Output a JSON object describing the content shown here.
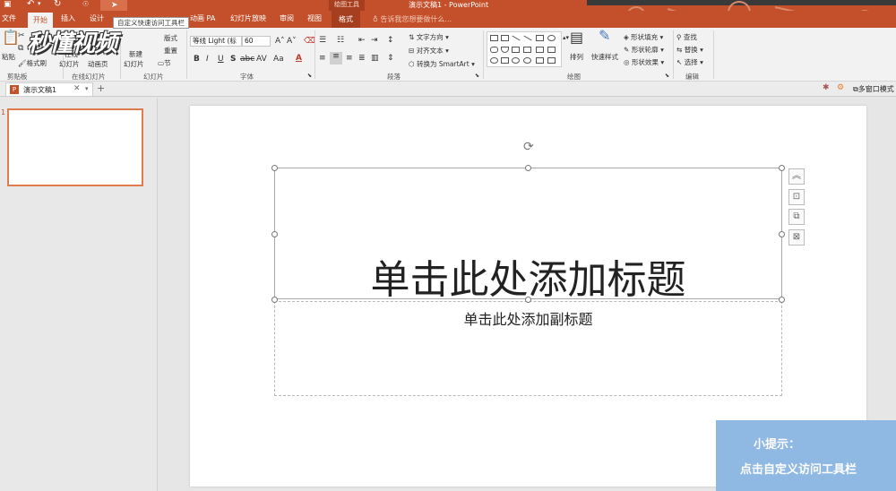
{
  "window": {
    "title": "演示文稿1 - PowerPoint",
    "drawing_tools": "绘图工具"
  },
  "tabs": [
    {
      "label": "文件"
    },
    {
      "label": "开始"
    },
    {
      "label": "插入"
    },
    {
      "label": "设计"
    },
    {
      "label": "动画 PA"
    },
    {
      "label": "幻灯片放映"
    },
    {
      "label": "审阅"
    },
    {
      "label": "视图"
    },
    {
      "label": "格式"
    }
  ],
  "tell_me": "告诉我您想要做什么...",
  "tooltip": "自定义快速访问工具栏",
  "watermark": "秒懂视频",
  "ribbon": {
    "clipboard": {
      "paste": "粘贴",
      "format_painter": "格式刷",
      "label": "剪贴板"
    },
    "online_slides": {
      "reuse": "重用",
      "slides": "幻灯片",
      "from": "在线",
      "layout": "版式",
      "reset": "重置",
      "new": "新建",
      "new_slides": "幻灯片",
      "section": "节",
      "animation": "动画页",
      "label_online": "在线幻灯片",
      "label_slides": "幻灯片"
    },
    "font": {
      "name": "等线 Light (标",
      "size": "60",
      "label": "字体",
      "bold": "B",
      "italic": "I",
      "underline": "U",
      "strike": "S",
      "spacing": "AV",
      "case": "Aa",
      "color": "A"
    },
    "paragraph": {
      "text_direction": "文字方向",
      "align_text": "对齐文本",
      "smartart": "转换为 SmartArt",
      "label": "段落"
    },
    "drawing": {
      "arrange": "排列",
      "quick_styles": "快速样式",
      "fill": "形状填充",
      "outline": "形状轮廓",
      "effects": "形状效果",
      "label": "绘图"
    },
    "editing": {
      "find": "查找",
      "replace": "替换",
      "select": "选择",
      "label": "编辑"
    }
  },
  "doc_tab": {
    "name": "演示文稿1",
    "multi_window": "多窗口模式"
  },
  "slide": {
    "title_placeholder": "单击此处添加标题",
    "subtitle_placeholder": "单击此处添加副标题",
    "thumb_number": "1"
  },
  "tip": {
    "heading": "小提示：",
    "body": "点击自定义访问工具栏"
  },
  "colors": {
    "accent": "#c3502a",
    "tip_bg": "#8fb8e2"
  }
}
